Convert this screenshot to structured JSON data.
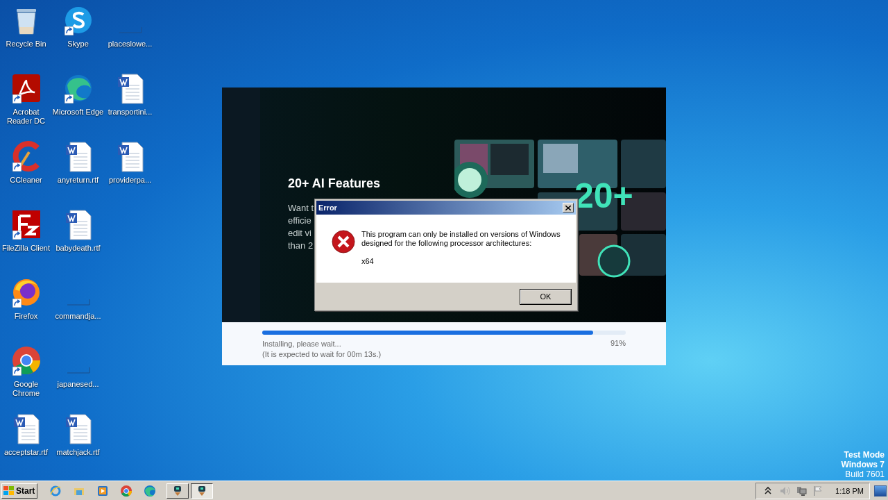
{
  "desktop_icons": [
    {
      "label": "Recycle Bin",
      "kind": "recycle",
      "shortcut": false
    },
    {
      "label": "Acrobat Reader DC",
      "kind": "acrobat",
      "shortcut": true
    },
    {
      "label": "CCleaner",
      "kind": "ccleaner",
      "shortcut": true
    },
    {
      "label": "FileZilla Client",
      "kind": "filezilla",
      "shortcut": true
    },
    {
      "label": "Firefox",
      "kind": "firefox",
      "shortcut": true
    },
    {
      "label": "Google Chrome",
      "kind": "chrome",
      "shortcut": true
    },
    {
      "label": "acceptstar.rtf",
      "kind": "word",
      "shortcut": false
    },
    {
      "label": "Skype",
      "kind": "skype",
      "shortcut": true
    },
    {
      "label": "Microsoft Edge",
      "kind": "edge",
      "shortcut": true
    },
    {
      "label": "anyreturn.rtf",
      "kind": "word",
      "shortcut": false
    },
    {
      "label": "babydeath.rtf",
      "kind": "word",
      "shortcut": false
    },
    {
      "label": "commandja...",
      "kind": "blank",
      "shortcut": false
    },
    {
      "label": "japanesed...",
      "kind": "blank",
      "shortcut": false
    },
    {
      "label": "matchjack.rtf",
      "kind": "word",
      "shortcut": false
    },
    {
      "label": "placeslowe...",
      "kind": "blank",
      "shortcut": false
    },
    {
      "label": "transportini...",
      "kind": "word",
      "shortcut": false
    },
    {
      "label": "providerpa...",
      "kind": "word",
      "shortcut": false
    }
  ],
  "installer": {
    "headline": "20+ AI Features",
    "description_lines": [
      "Want t",
      "efficie",
      "edit vi",
      "than 2"
    ],
    "badge": "20+",
    "progress": {
      "level": 0.91,
      "status": "Installing, please wait...",
      "hint": "(It is expected to wait for 00m 13s.)",
      "percent": "91%"
    }
  },
  "error_dialog": {
    "title": "Error",
    "message": "This program can only be installed on versions of Windows designed for the following processor architectures:",
    "detail": "x64",
    "button": "OK"
  },
  "watermark_text": [
    "Test Mode",
    "Windows 7",
    "Build 7601"
  ],
  "taskbar": {
    "start": "Start",
    "quick_launch": [
      {
        "kind": "ie"
      },
      {
        "kind": "explorer"
      },
      {
        "kind": "media"
      },
      {
        "kind": "chrome"
      },
      {
        "kind": "edge"
      }
    ],
    "tasks": [
      {
        "kind": "installer",
        "selected": false
      },
      {
        "kind": "installer",
        "selected": true
      }
    ],
    "tray": [
      {
        "kind": "chevron"
      },
      {
        "kind": "speaker"
      },
      {
        "kind": "network"
      },
      {
        "kind": "flag"
      }
    ],
    "clock": "1:18 PM"
  }
}
